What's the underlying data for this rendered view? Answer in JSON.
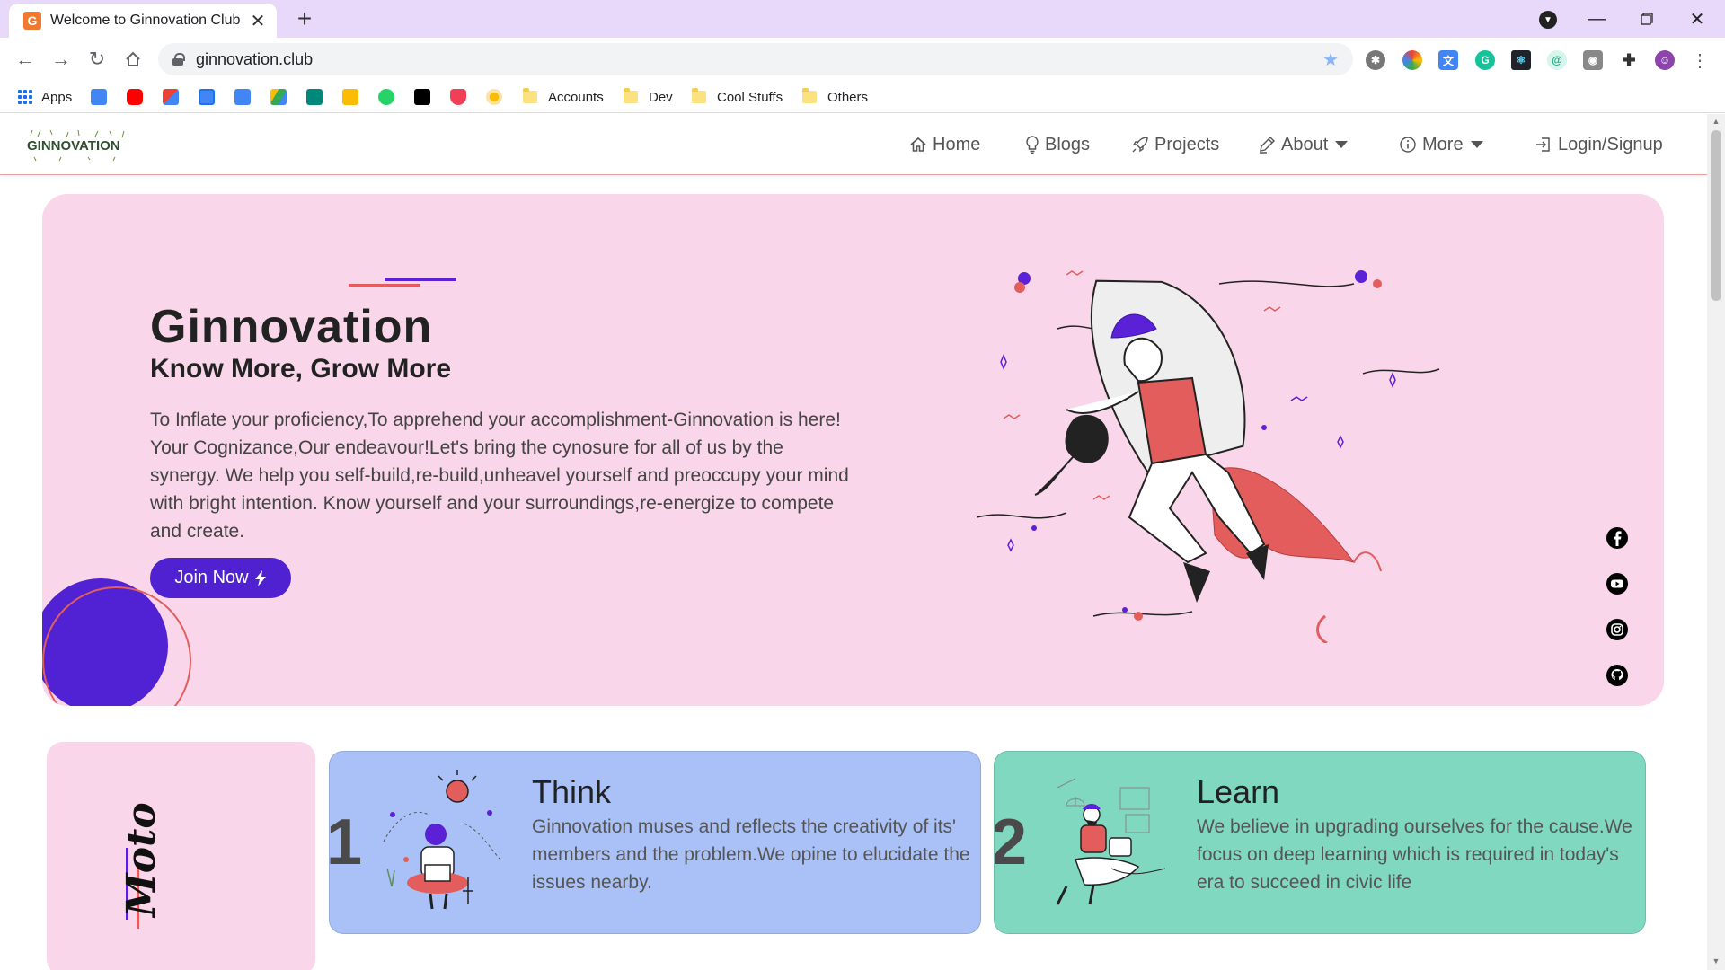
{
  "browser": {
    "tab_title": "Welcome to Ginnovation Club",
    "favicon_letter": "G",
    "url": "ginnovation.club",
    "bookmarks": {
      "apps_label": "Apps",
      "folders": [
        "Accounts",
        "Dev",
        "Cool Stuffs",
        "Others"
      ]
    }
  },
  "nav": {
    "logo_text": "GINNOVATION",
    "items": [
      "Home",
      "Blogs",
      "Projects",
      "About",
      "More",
      "Login/Signup"
    ]
  },
  "hero": {
    "title": "Ginnovation",
    "subtitle": "Know More, Grow More",
    "description": "To Inflate your proficiency,To apprehend your accomplishment-Ginnovation is here! Your Cognizance,Our endeavour!Let's bring the cynosure for all of us by the synergy. We help you self-build,re-build,unheavel yourself and preoccupy your mind with bright intention. Know yourself and your surroundings,re-energize to compete and create.",
    "cta_label": "Join Now"
  },
  "social": [
    "facebook-icon",
    "youtube-icon",
    "instagram-icon",
    "github-icon"
  ],
  "moto": {
    "label": "Moto"
  },
  "features": [
    {
      "number": "1",
      "title": "Think",
      "text": "Ginnovation muses and reflects the creativity of its' members and the problem.We opine to elucidate the issues nearby.",
      "color": "#a9c1f7"
    },
    {
      "number": "2",
      "title": "Learn",
      "text": "We believe in upgrading ourselves for the cause.We focus on deep learning which is required in today's era to succeed in civic life",
      "color": "#7fd8bf"
    }
  ],
  "colors": {
    "accent": "#5122d4",
    "hero_bg": "#f9d6ea",
    "red_accent": "#e35d5d",
    "tab_strip": "#e8d9fb"
  }
}
